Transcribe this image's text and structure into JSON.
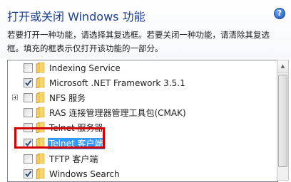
{
  "window": {
    "title": "打开或关闭 Windows 功能",
    "help_icon": "help-icon",
    "help_glyph": "?"
  },
  "description": {
    "line1": "若要打开一种功能，请选择其复选框。若要关闭一种功能，请清除其复选",
    "line2": "框。填充的框表示仅打开该功能的一部分。"
  },
  "features": [
    {
      "label": "Indexing Service",
      "checked": false,
      "expandable": false,
      "selected": false
    },
    {
      "label": "Microsoft .NET Framework 3.5.1",
      "checked": true,
      "expandable": false,
      "selected": false
    },
    {
      "label": "NFS 服务",
      "checked": false,
      "expandable": true,
      "selected": false
    },
    {
      "label": "RAS 连接管理器管理工具包(CMAK)",
      "checked": false,
      "expandable": false,
      "selected": false
    },
    {
      "label": "Telnet 服务器",
      "checked": false,
      "expandable": false,
      "selected": false
    },
    {
      "label": "Telnet 客户端",
      "checked": true,
      "expandable": false,
      "selected": true,
      "highlighted": true
    },
    {
      "label": "TFTP 客户端",
      "checked": false,
      "expandable": false,
      "selected": false
    },
    {
      "label": "Windows Search",
      "checked": true,
      "expandable": false,
      "selected": false
    }
  ],
  "colors": {
    "title": "#1b3f8f",
    "selection": "#3399ff",
    "highlight_border": "#d40000",
    "checkmark": "#2a4a8a"
  }
}
